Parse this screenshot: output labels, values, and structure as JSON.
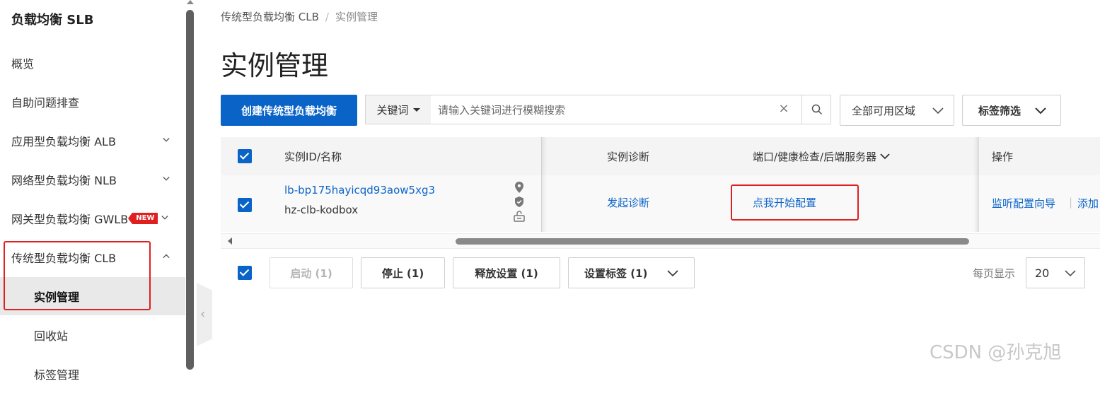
{
  "sidebar": {
    "title": "负载均衡 SLB",
    "items": [
      {
        "label": "概览"
      },
      {
        "label": "自助问题排查"
      },
      {
        "label": "应用型负载均衡 ALB"
      },
      {
        "label": "网络型负载均衡 NLB"
      },
      {
        "label": "网关型负载均衡 GWLB",
        "badge": "NEW"
      },
      {
        "label": "传统型负载均衡 CLB"
      },
      {
        "label": "实例管理"
      },
      {
        "label": "回收站"
      },
      {
        "label": "标签管理"
      }
    ]
  },
  "breadcrumb": {
    "parent": "传统型负载均衡 CLB",
    "separator": "/",
    "current": "实例管理"
  },
  "page_title": "实例管理",
  "toolbar": {
    "create_label": "创建传统型负载均衡",
    "keyword_label": "关键词",
    "search_placeholder": "请输入关键词进行模糊搜索",
    "clear_glyph": "×",
    "zone_label": "全部可用区域",
    "tag_filter_label": "标签筛选"
  },
  "table": {
    "columns": {
      "id_name": "实例ID/名称",
      "diagnose": "实例诊断",
      "ports": "端口/健康检查/后端服务器",
      "actions": "操作"
    },
    "rows": [
      {
        "id": "lb-bp175hayicqd93aow5xg3",
        "name": "hz-clb-kodbox",
        "diagnose": "发起诊断",
        "config": "点我开始配置",
        "action_1": "监听配置向导",
        "action_sep": "|",
        "action_2": "添加"
      }
    ]
  },
  "bulk": {
    "start": "启动 (1)",
    "stop": "停止 (1)",
    "release": "释放设置 (1)",
    "set_tags": "设置标签 (1)"
  },
  "pagination": {
    "per_page_label": "每页显示",
    "per_page_value": "20"
  },
  "watermark": "CSDN @孙克旭",
  "colors": {
    "primary": "#0a64c8",
    "highlight_box": "#e02020",
    "badge": "#e02020"
  }
}
